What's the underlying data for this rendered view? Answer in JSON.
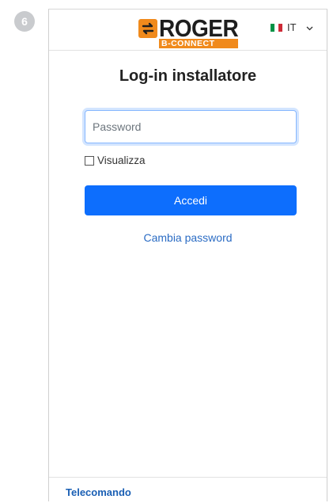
{
  "step": {
    "number": "6"
  },
  "header": {
    "logo": {
      "main": "ROGER",
      "sub": "B-CONNECT"
    },
    "language": {
      "code": "IT",
      "flag_colors": [
        "#009246",
        "#ffffff",
        "#ce2b37"
      ]
    }
  },
  "main": {
    "title": "Log-in installatore",
    "password": {
      "placeholder": "Password",
      "value": ""
    },
    "show_password": {
      "label": "Visualizza",
      "checked": false
    },
    "submit_label": "Accedi",
    "change_password_label": "Cambia password"
  },
  "footer": {
    "link_label": "Telecomando"
  },
  "colors": {
    "accent": "#0d6efd",
    "link": "#2b6cc4",
    "brand_orange": "#f08a1c",
    "step_badge": "#c9cbce"
  },
  "icons": [
    "swap-arrows-icon",
    "italy-flag-icon",
    "chevron-down-icon",
    "checkbox-icon"
  ]
}
